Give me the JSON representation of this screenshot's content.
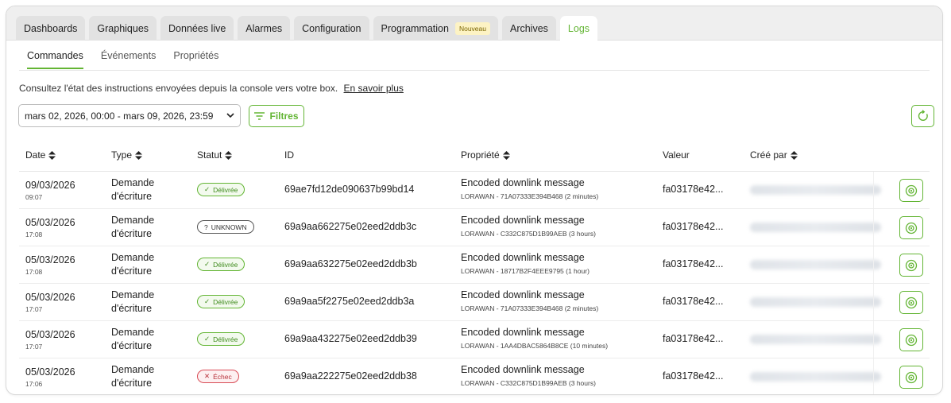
{
  "tabs": [
    {
      "label": "Dashboards",
      "active": false
    },
    {
      "label": "Graphiques",
      "active": false
    },
    {
      "label": "Données live",
      "active": false
    },
    {
      "label": "Alarmes",
      "active": false
    },
    {
      "label": "Configuration",
      "active": false
    },
    {
      "label": "Programmation",
      "badge": "Nouveau",
      "active": false
    },
    {
      "label": "Archives",
      "active": false
    },
    {
      "label": "Logs",
      "active": true
    }
  ],
  "subtabs": [
    {
      "label": "Commandes",
      "active": true
    },
    {
      "label": "Événements",
      "active": false
    },
    {
      "label": "Propriétés",
      "active": false
    }
  ],
  "intro": {
    "text": "Consultez l'état des instructions envoyées depuis la console vers votre box.",
    "link": "En savoir plus"
  },
  "toolbar": {
    "date_range": "mars 02, 2026, 00:00 - mars 09, 2026, 23:59",
    "filters_label": "Filtres"
  },
  "columns": {
    "date": "Date",
    "type": "Type",
    "status": "Statut",
    "id": "ID",
    "property": "Propriété",
    "value": "Valeur",
    "created_by": "Créé par"
  },
  "rows": [
    {
      "date": "09/03/2026",
      "time": "09:07",
      "type1": "Demande",
      "type2": "d'écriture",
      "status": "Délivrée",
      "status_kind": "ok",
      "id": "69ae7fd12de090637b99bd14",
      "prop": "Encoded downlink message",
      "prop_sub": "LORAWAN - 71A07333E394B468 (2 minutes)",
      "value": "fa03178e42..."
    },
    {
      "date": "05/03/2026",
      "time": "17:08",
      "type1": "Demande",
      "type2": "d'écriture",
      "status": "UNKNOWN",
      "status_kind": "unk",
      "id": "69a9aa662275e02eed2ddb3c",
      "prop": "Encoded downlink message",
      "prop_sub": "LORAWAN - C332C875D1B99AEB (3 hours)",
      "value": "fa03178e42..."
    },
    {
      "date": "05/03/2026",
      "time": "17:08",
      "type1": "Demande",
      "type2": "d'écriture",
      "status": "Délivrée",
      "status_kind": "ok",
      "id": "69a9aa632275e02eed2ddb3b",
      "prop": "Encoded downlink message",
      "prop_sub": "LORAWAN - 18717B2F4EEE9795 (1 hour)",
      "value": "fa03178e42..."
    },
    {
      "date": "05/03/2026",
      "time": "17:07",
      "type1": "Demande",
      "type2": "d'écriture",
      "status": "Délivrée",
      "status_kind": "ok",
      "id": "69a9aa5f2275e02eed2ddb3a",
      "prop": "Encoded downlink message",
      "prop_sub": "LORAWAN - 71A07333E394B468 (2 minutes)",
      "value": "fa03178e42..."
    },
    {
      "date": "05/03/2026",
      "time": "17:07",
      "type1": "Demande",
      "type2": "d'écriture",
      "status": "Délivrée",
      "status_kind": "ok",
      "id": "69a9aa432275e02eed2ddb39",
      "prop": "Encoded downlink message",
      "prop_sub": "LORAWAN - 1AA4DBAC5864B8CE (10 minutes)",
      "value": "fa03178e42..."
    },
    {
      "date": "05/03/2026",
      "time": "17:06",
      "type1": "Demande",
      "type2": "d'écriture",
      "status": "Échec",
      "status_kind": "fail",
      "id": "69a9aa222275e02eed2ddb38",
      "prop": "Encoded downlink message",
      "prop_sub": "LORAWAN - C332C875D1B99AEB (3 hours)",
      "value": "fa03178e42..."
    }
  ],
  "colors": {
    "accent": "#63b534",
    "fail": "#d94b55",
    "badge_bg": "#fdf3c4"
  },
  "icons": {
    "sort": "sort-icon",
    "chevron": "chevron-down-icon",
    "filter": "filter-icon",
    "refresh": "refresh-icon",
    "view": "eye-icon"
  }
}
